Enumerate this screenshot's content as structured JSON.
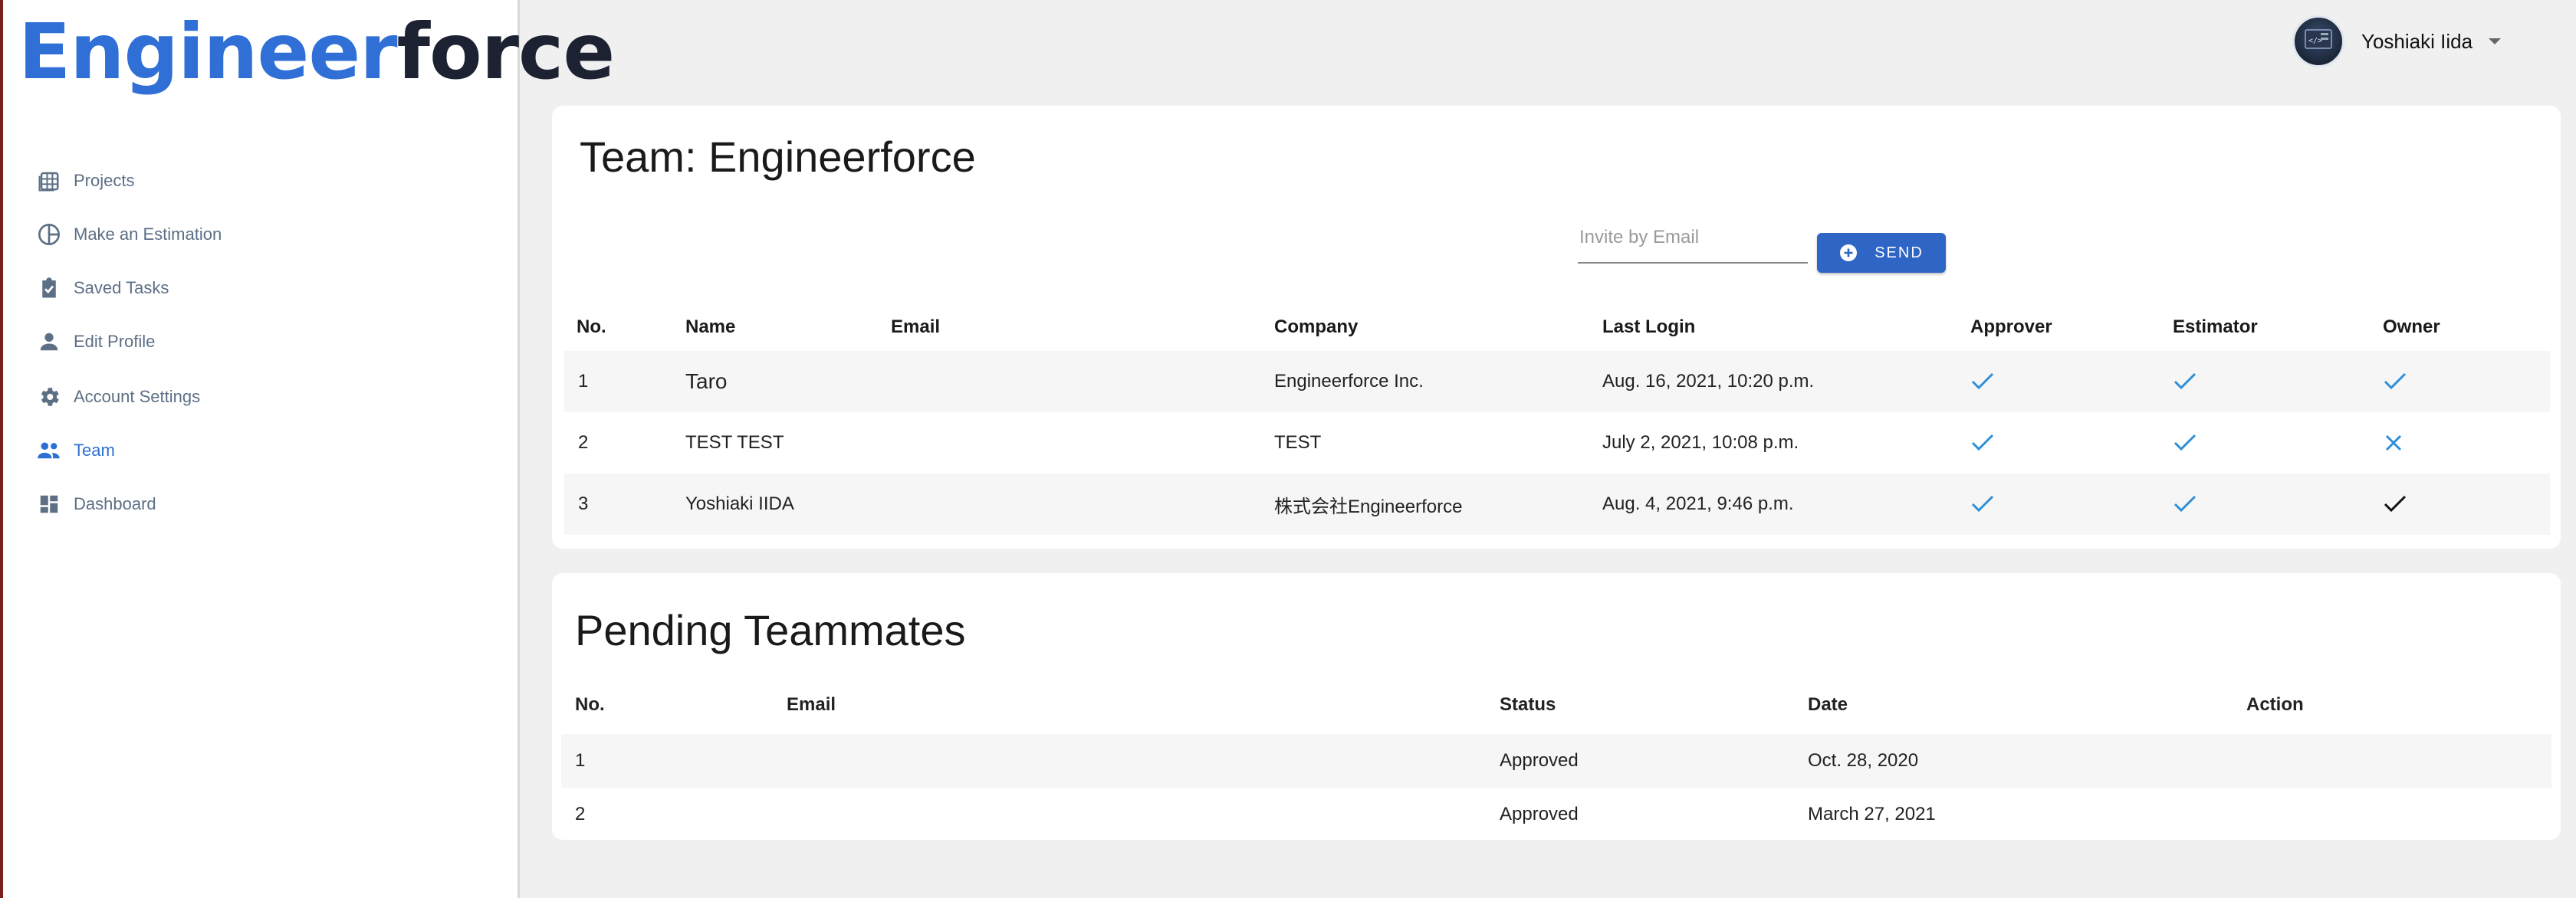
{
  "logo": {
    "part1": "Engineer",
    "part2": "force"
  },
  "sidebar": {
    "items": [
      {
        "label": "Projects",
        "icon": "grid-table-icon"
      },
      {
        "label": "Make an Estimation",
        "icon": "pie-chart-icon"
      },
      {
        "label": "Saved Tasks",
        "icon": "clipboard-check-icon"
      },
      {
        "label": "Edit Profile",
        "icon": "person-icon"
      },
      {
        "label": "Account Settings",
        "icon": "gear-icon"
      },
      {
        "label": "Team",
        "icon": "people-icon",
        "active": true
      },
      {
        "label": "Dashboard",
        "icon": "dashboard-icon"
      }
    ]
  },
  "header": {
    "user_name": "Yoshiaki Iida"
  },
  "team": {
    "title": "Team: Engineerforce",
    "invite_placeholder": "Invite by Email",
    "invite_value": "",
    "send_label": "SEND",
    "columns": [
      "No.",
      "Name",
      "Email",
      "Company",
      "Last Login",
      "Approver",
      "Estimator",
      "Owner"
    ],
    "rows": [
      {
        "no": "1",
        "name": "Taro",
        "email": "",
        "company": "Engineerforce Inc.",
        "last_login": "Aug. 16, 2021, 10:20 p.m.",
        "approver": "check",
        "estimator": "check",
        "owner": "check"
      },
      {
        "no": "2",
        "name": "TEST TEST",
        "email": "",
        "company": "TEST",
        "last_login": "July 2, 2021, 10:08 p.m.",
        "approver": "check",
        "estimator": "check",
        "owner": "cross"
      },
      {
        "no": "3",
        "name": "Yoshiaki IIDA",
        "email": "",
        "company": "株式会社Engineerforce",
        "last_login": "Aug. 4, 2021, 9:46 p.m.",
        "approver": "check",
        "estimator": "check",
        "owner": "check-black"
      }
    ]
  },
  "pending": {
    "title": "Pending Teammates",
    "columns": [
      "No.",
      "Email",
      "Status",
      "Date",
      "Action"
    ],
    "rows": [
      {
        "no": "1",
        "email": "",
        "status": "Approved",
        "date": "Oct. 28, 2020",
        "action": ""
      },
      {
        "no": "2",
        "email": "",
        "status": "Approved",
        "date": "March 27, 2021",
        "action": ""
      }
    ]
  },
  "colors": {
    "accent": "#2f66c5",
    "check": "#2d8fd8",
    "nav_text": "#5c6f85",
    "logo_blue": "#2f6fd6",
    "logo_dark": "#1d2233"
  }
}
